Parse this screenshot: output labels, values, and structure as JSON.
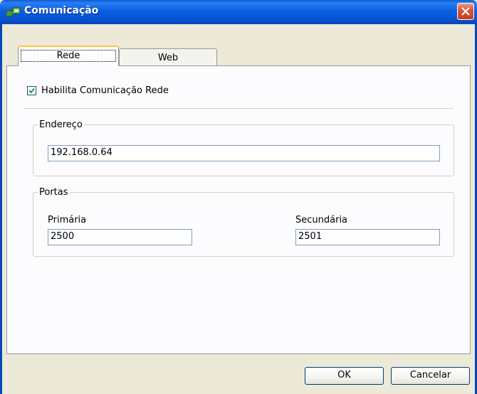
{
  "window": {
    "title": "Comunicação",
    "icon": "network-icon",
    "close_icon": "close-icon"
  },
  "tabs": [
    {
      "label": "Rede",
      "selected": true
    },
    {
      "label": "Web",
      "selected": false
    }
  ],
  "rede": {
    "enable_label": "Habilita Comunicação Rede",
    "enable_checked": true,
    "endereco_group": "Endereço",
    "endereco_value": "192.168.0.64",
    "portas_group": "Portas",
    "primaria_label": "Primária",
    "primaria_value": "2500",
    "secundaria_label": "Secundária",
    "secundaria_value": "2501"
  },
  "buttons": {
    "ok": "OK",
    "cancel": "Cancelar"
  },
  "colors": {
    "titlebar": "#0a5ee4",
    "close": "#c73c1e",
    "face": "#ece9d8"
  }
}
